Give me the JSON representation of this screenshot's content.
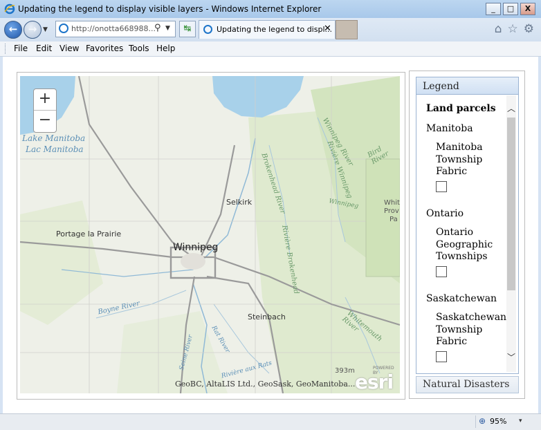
{
  "window": {
    "title": "Updating the legend to display visible layers - Windows Internet Explorer",
    "buttons": {
      "minimize": "_",
      "maximize": "□",
      "close": "X"
    }
  },
  "navigation": {
    "back_icon": "back-arrow-icon",
    "forward_icon": "forward-arrow-icon",
    "address": "http://onotta668988...",
    "tab_title": "Updating the legend to displ...",
    "tab_close": "✕",
    "search_glyph": "⚲",
    "compat_glyph": "↹",
    "home_glyph": "⌂",
    "favorites_glyph": "☆",
    "tools_glyph": "⚙"
  },
  "menu": {
    "items": [
      "File",
      "Edit",
      "View",
      "Favorites",
      "Tools",
      "Help"
    ]
  },
  "map": {
    "zoom_in": "+",
    "zoom_out": "−",
    "labels": {
      "lake_en": "Lake Manitoba",
      "lake_fr": "Lac Manitoba",
      "selkirk": "Selkirk",
      "portage": "Portage la Prairie",
      "winnipeg": "Winnipeg",
      "steinbach": "Steinbach",
      "boyne": "Boyne River",
      "seine": "Seine River",
      "rat": "Rat River",
      "riviere_aux_rats": "Rivière aux Rats",
      "brokenhead": "Brokenhead River",
      "riviere_brokenhead": "Rivière Brokenhead",
      "winnipeg_river": "Winnipeg River",
      "riviere_winnipeg": "Rivière Winnipeg",
      "winnipeg_small": "Winnipeg",
      "bird_river": "Bird River",
      "whitemouth": "Whitemouth River",
      "whiteshell_1": "Whit",
      "whiteshell_2": "Prov",
      "whiteshell_3": "Pa"
    },
    "scale": "393m",
    "powered": "POWERED BY",
    "logo": "esri",
    "attribution": "GeoBC, AltaLIS Ltd., GeoSask, GeoManitoba..."
  },
  "legend": {
    "header": "Legend",
    "group_title": "Land parcels",
    "provinces": [
      {
        "name": "Manitoba",
        "layer": [
          "Manitoba",
          "Township",
          "Fabric"
        ]
      },
      {
        "name": "Ontario",
        "layer": [
          "Ontario",
          "Geographic",
          "Townships"
        ]
      },
      {
        "name": "Saskatchewan",
        "layer": [
          "Saskatchewan",
          "Township",
          "Fabric"
        ]
      }
    ],
    "scroll_up": "︿",
    "scroll_down": "﹀"
  },
  "natural_disasters": {
    "label": "Natural Disasters"
  },
  "status": {
    "zoom": "95%",
    "zoom_drop": "▾"
  },
  "colors": {
    "water": "#a8d1ea",
    "land": "#eef0e8",
    "vegetation": "#d4e5c2",
    "highway": "#9a9a9a",
    "accent": "#9ab3d2"
  }
}
